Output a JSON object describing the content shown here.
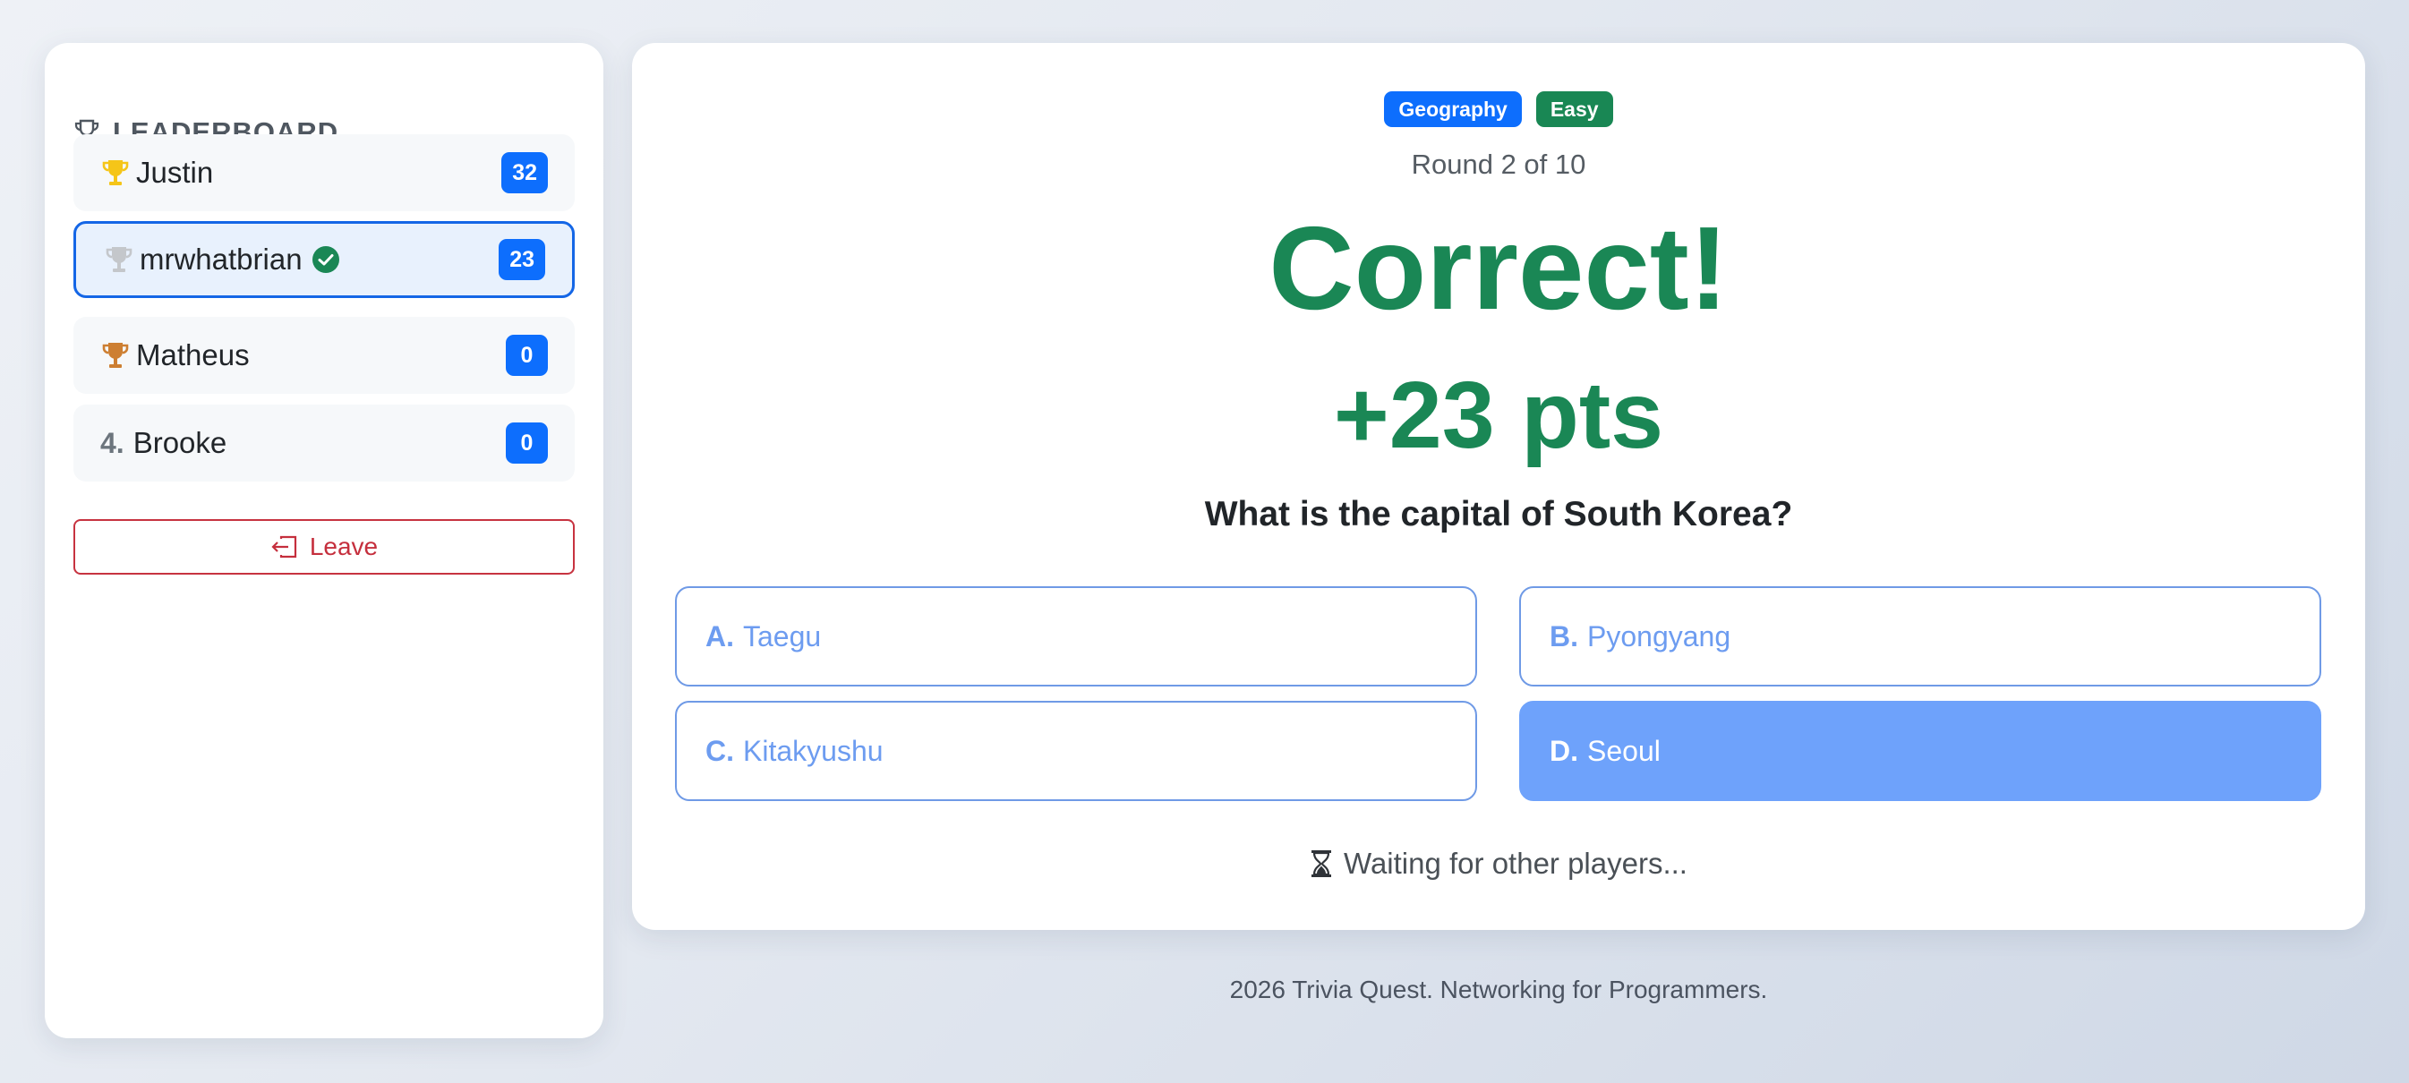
{
  "leaderboard": {
    "title": "LEADERBOARD",
    "players": [
      {
        "rank": "1",
        "rank_display": "trophy-gold",
        "name": "Justin",
        "score": "32",
        "is_self": false
      },
      {
        "rank": "2",
        "rank_display": "trophy-silver",
        "name": "mrwhatbrian",
        "score": "23",
        "is_self": true,
        "verified": true
      },
      {
        "rank": "3",
        "rank_display": "trophy-bronze",
        "name": "Matheus",
        "score": "0",
        "is_self": false
      },
      {
        "rank": "4",
        "rank_display": "4.",
        "name": "Brooke",
        "score": "0",
        "is_self": false
      }
    ],
    "leave_label": "Leave"
  },
  "game": {
    "category": "Geography",
    "difficulty": "Easy",
    "round": "Round 2 of 10",
    "result": "Correct!",
    "points": "+23 pts",
    "question": "What is the capital of South Korea?",
    "answers": [
      {
        "letter": "A.",
        "text": "Taegu",
        "selected": false
      },
      {
        "letter": "B.",
        "text": "Pyongyang",
        "selected": false
      },
      {
        "letter": "C.",
        "text": "Kitakyushu",
        "selected": false
      },
      {
        "letter": "D.",
        "text": "Seoul",
        "selected": true
      }
    ],
    "status": "Waiting for other players..."
  },
  "footer": "2026 Trivia Quest. Networking for Programmers.",
  "colors": {
    "primary": "#0d6efd",
    "success": "#198754",
    "danger": "#c52f3d",
    "gold": "#f5c518",
    "silver": "#c4c7cb",
    "bronze": "#cd7f32",
    "answer_selected": "#6ea2fb"
  }
}
